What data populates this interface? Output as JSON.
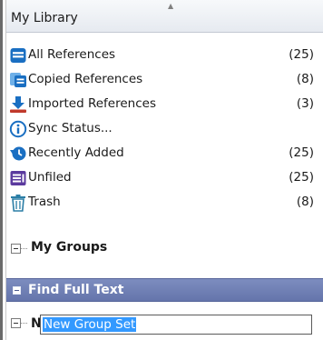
{
  "header": {
    "title": "My Library"
  },
  "library_items": [
    {
      "id": "all-references",
      "label": "All References",
      "count": "(25)",
      "icon": "all-references-icon"
    },
    {
      "id": "copied-references",
      "label": "Copied References",
      "count": "(8)",
      "icon": "copied-references-icon"
    },
    {
      "id": "imported-references",
      "label": "Imported References",
      "count": "(3)",
      "icon": "import-download-icon"
    },
    {
      "id": "sync-status",
      "label": "Sync Status...",
      "count": "",
      "icon": "info-icon"
    },
    {
      "id": "recently-added",
      "label": "Recently Added",
      "count": "(25)",
      "icon": "history-clock-icon"
    },
    {
      "id": "unfiled",
      "label": "Unfiled",
      "count": "(25)",
      "icon": "unfiled-icon"
    },
    {
      "id": "trash",
      "label": "Trash",
      "count": "(8)",
      "icon": "trash-icon"
    }
  ],
  "groups": {
    "label": "My Groups"
  },
  "find_full_text": {
    "label": "Find Full Text"
  },
  "new_group_set": {
    "prefix": "N",
    "value": "New Group Set"
  },
  "colors": {
    "icon_blue": "#1a6fc2",
    "unfiled_purple": "#5b3a9e",
    "trash_teal": "#2b7ea6",
    "find_full_text_bar": "#6e7eb5",
    "selection_blue": "#3399ff"
  }
}
